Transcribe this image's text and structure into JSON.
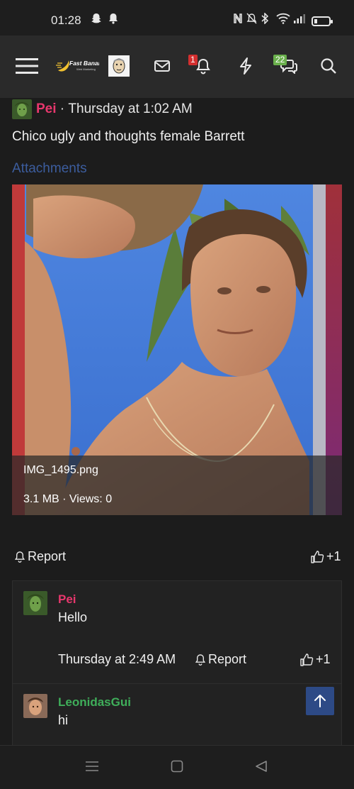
{
  "status_bar": {
    "time": "01:28",
    "icons": [
      "snapchat-icon",
      "notification-bell-icon",
      "nfc-icon",
      "mute-icon",
      "bluetooth-icon",
      "wifi-icon",
      "signal-icon",
      "battery-icon"
    ]
  },
  "navbar": {
    "logo_text": "Fast Banana",
    "logo_subtext": "Web Marketing",
    "alerts_badge": "1",
    "conversations_badge": "22",
    "colors": {
      "alerts_badge": "#d32f2f",
      "conversations_badge": "#6ab04c"
    }
  },
  "post": {
    "author": "Pei",
    "separator": " · ",
    "date": "Thursday at 1:02 AM",
    "body": "Chico ugly and thoughts female Barrett",
    "attachments_title": "Attachments",
    "attachment": {
      "filename": "IMG_1495.png",
      "meta": "3.1 MB · Views: 0"
    },
    "report_label": "Report",
    "reaction_label": "+1"
  },
  "replies": [
    {
      "author": "Pei",
      "text": "Hello",
      "date": "Thursday at 2:49 AM",
      "report_label": "Report",
      "reaction_label": "+1"
    },
    {
      "author": "LeonidasGui",
      "text": "hi"
    }
  ],
  "colors": {
    "accent_pink": "#e8376d",
    "accent_green": "#3fae5a",
    "link_blue": "#3c5d9e",
    "scroll_top_bg": "#2d4a86"
  }
}
